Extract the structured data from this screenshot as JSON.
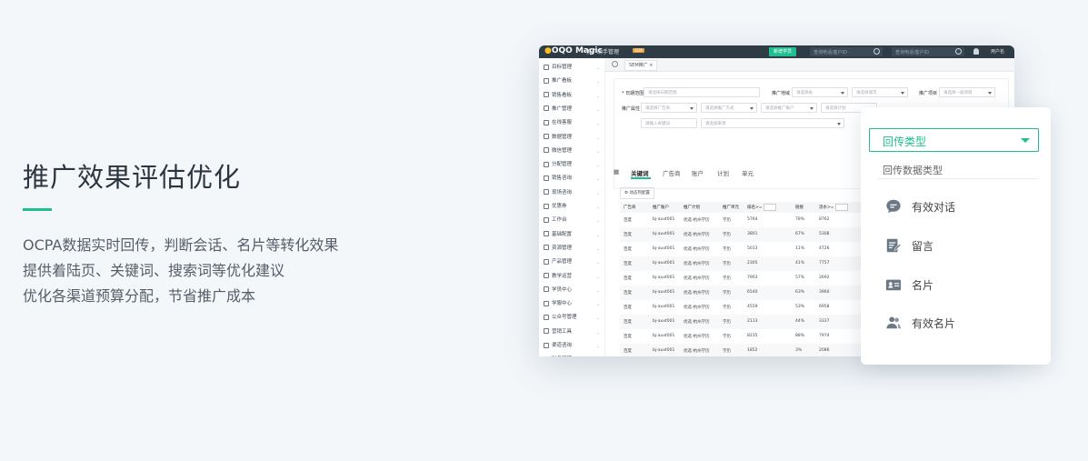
{
  "hero": {
    "title": "推广效果评估优化",
    "lines": [
      "OCPA数据实时回传，判断会话、名片等转化效果",
      "提供着陆页、关键词、搜索词等优化建议",
      "优化各渠道预算分配，节省推广成本"
    ]
  },
  "app": {
    "logo": "OQO Magic",
    "brand": "推广助手管理",
    "brand_tag": "SEM",
    "new_button": "新增学员",
    "search1_placeholder": "查询电话/客户ID",
    "search2_placeholder": "查询电话/客户ID",
    "user": "用户名",
    "tab": "SEM推广",
    "sidebar": [
      "目标管理",
      "推广看板",
      "销售看板",
      "推广管理",
      "在线客服",
      "数据管理",
      "微信管理",
      "分配管理",
      "销售咨询",
      "现场咨询",
      "优惠券",
      "工作台",
      "基础配置",
      "资源管理",
      "产品管理",
      "教学运营",
      "学员中心",
      "学服中心",
      "公众号管理",
      "营销工具",
      "渠道咨询",
      "财务管理"
    ],
    "filters": {
      "date_label": "* 日期范围",
      "date_placeholder": "请选择日期范围",
      "platform_label": "推广地域",
      "platform_placeholder": "请选择省",
      "city_placeholder": "请选择城市",
      "project_label": "推广项目",
      "project_placeholder": "请选择一级项目",
      "attr_label": "推广属性",
      "attr_placeholder": "请选择广告商",
      "method_placeholder": "请选择推广方式",
      "account_placeholder": "请选择推广账户",
      "plan_placeholder": "请选择计划",
      "keyword_placeholder": "请输入关键词",
      "source_placeholder": "请选择来源"
    },
    "data_tabs": [
      "关键词",
      "广告商",
      "账户",
      "计划",
      "单元"
    ],
    "config_button": "动态列配置",
    "table_headers": [
      "广告商",
      "推广账户",
      "推广计划",
      "推广单元",
      "排名>=",
      "链接",
      "流水>="
    ],
    "rows": [
      [
        "百度",
        "bj-auxt001",
        "优选-杭州学历",
        "学历",
        "5764",
        "78%",
        "8762"
      ],
      [
        "百度",
        "bj-auxt001",
        "优选-杭州学历",
        "学历",
        "3801",
        "67%",
        "5308"
      ],
      [
        "百度",
        "bj-auxt001",
        "优选-杭州学历",
        "学历",
        "5013",
        "11%",
        "4726"
      ],
      [
        "百度",
        "bj-auxt001",
        "优选-杭州学历",
        "学历",
        "2305",
        "41%",
        "7757"
      ],
      [
        "百度",
        "bj-auxt001",
        "优选-杭州学历",
        "学历",
        "7903",
        "57%",
        "2692"
      ],
      [
        "百度",
        "bj-auxt001",
        "优选-杭州学历",
        "学历",
        "6540",
        "63%",
        "3960"
      ],
      [
        "百度",
        "bj-auxt001",
        "优选-杭州学历",
        "学历",
        "4559",
        "53%",
        "6958"
      ],
      [
        "百度",
        "bj-auxt001",
        "优选-杭州学历",
        "学历",
        "2113",
        "44%",
        "3337"
      ],
      [
        "百度",
        "bj-auxt001",
        "优选-杭州学历",
        "学历",
        "8235",
        "88%",
        "7974"
      ],
      [
        "百度",
        "bj-auxt001",
        "优选-杭州学历",
        "学历",
        "1852",
        "3%",
        "2086"
      ]
    ]
  },
  "dropdown": {
    "selected": "回传类型",
    "sub_label": "回传数据类型",
    "options": [
      {
        "label": "有效对话",
        "icon": "chat-bubble-icon"
      },
      {
        "label": "留言",
        "icon": "note-edit-icon"
      },
      {
        "label": "名片",
        "icon": "id-card-icon"
      },
      {
        "label": "有效名片",
        "icon": "users-icon"
      }
    ]
  },
  "colors": {
    "accent": "#1fbf8f",
    "topbar": "#2f3b45",
    "background": "#f4f7fa"
  }
}
